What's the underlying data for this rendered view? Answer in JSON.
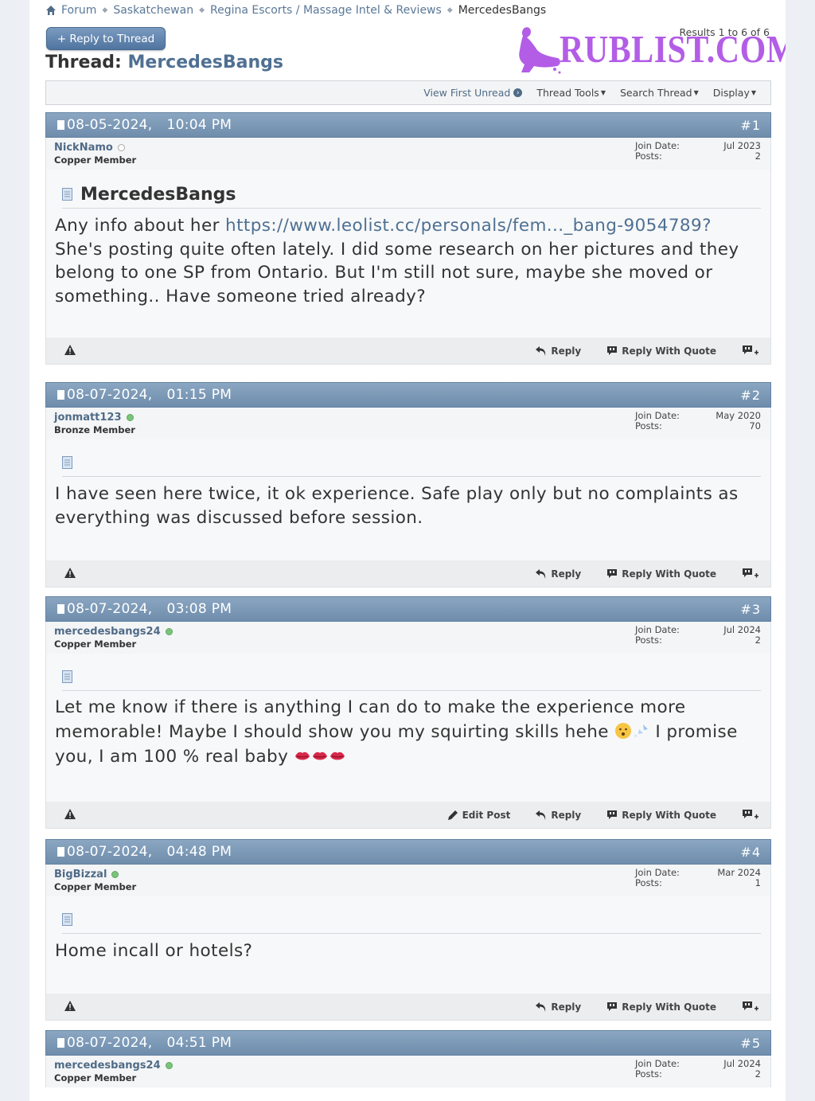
{
  "breadcrumb": {
    "items": [
      "Forum",
      "Saskatchewan",
      "Regina Escorts / Massage Intel & Reviews"
    ],
    "current": "MercedesBangs"
  },
  "reply_button": "+ Reply to Thread",
  "thread": {
    "prefix": "Thread:",
    "name": "MercedesBangs"
  },
  "results": "Results 1 to 6 of 6",
  "watermark": {
    "text": "RUBLIST.COM",
    "color": "#b35de6"
  },
  "toolbar": {
    "view_first_unread": "View First Unread",
    "thread_tools": "Thread Tools",
    "search_thread": "Search Thread",
    "display": "Display"
  },
  "labels": {
    "join_date": "Join Date:",
    "posts": "Posts:",
    "reply": "Reply",
    "reply_with_quote": "Reply With Quote",
    "edit_post": "Edit Post"
  },
  "posts": [
    {
      "date": "08-05-2024,",
      "time": "10:04 PM",
      "num": "#1",
      "user": "NickNamo",
      "online": false,
      "rank": "Copper Member",
      "join_date": "Jul 2023",
      "post_count": "2",
      "title": "MercedesBangs",
      "text_before": "Any info about her ",
      "link": "https://www.leolist.cc/personals/fem..._bang-9054789?",
      "text_after": " She's posting quite often lately. I did some research on her pictures and they belong to one SP from Ontario. But I'm still not sure, maybe she moved or something.. Have someone tried already?"
    },
    {
      "date": "08-07-2024,",
      "time": "01:15 PM",
      "num": "#2",
      "user": "jonmatt123",
      "online": true,
      "rank": "Bronze Member",
      "join_date": "May 2020",
      "post_count": "70",
      "text": "I have seen here twice, it ok experience. Safe play only but no complaints as everything was discussed before session."
    },
    {
      "date": "08-07-2024,",
      "time": "03:08 PM",
      "num": "#3",
      "user": "mercedesbangs24",
      "online": true,
      "rank": "Copper Member",
      "join_date": "Jul 2024",
      "post_count": "2",
      "text_a": "Let me know if there is anything I can do to make the experience more memorable! Maybe I should show you my squirting skills hehe",
      "text_b": " I promise you, I am 100 % real baby",
      "emojis": [
        "hush-face-emoji",
        "sweat-droplets-emoji",
        "lips-emoji"
      ]
    },
    {
      "date": "08-07-2024,",
      "time": "04:48 PM",
      "num": "#4",
      "user": "BigBizzal",
      "online": true,
      "rank": "Copper Member",
      "join_date": "Mar 2024",
      "post_count": "1",
      "text": "Home incall or hotels?"
    },
    {
      "date": "08-07-2024,",
      "time": "04:51 PM",
      "num": "#5",
      "user": "mercedesbangs24",
      "online": true,
      "rank": "Copper Member",
      "join_date": "Jul 2024",
      "post_count": "2"
    }
  ]
}
